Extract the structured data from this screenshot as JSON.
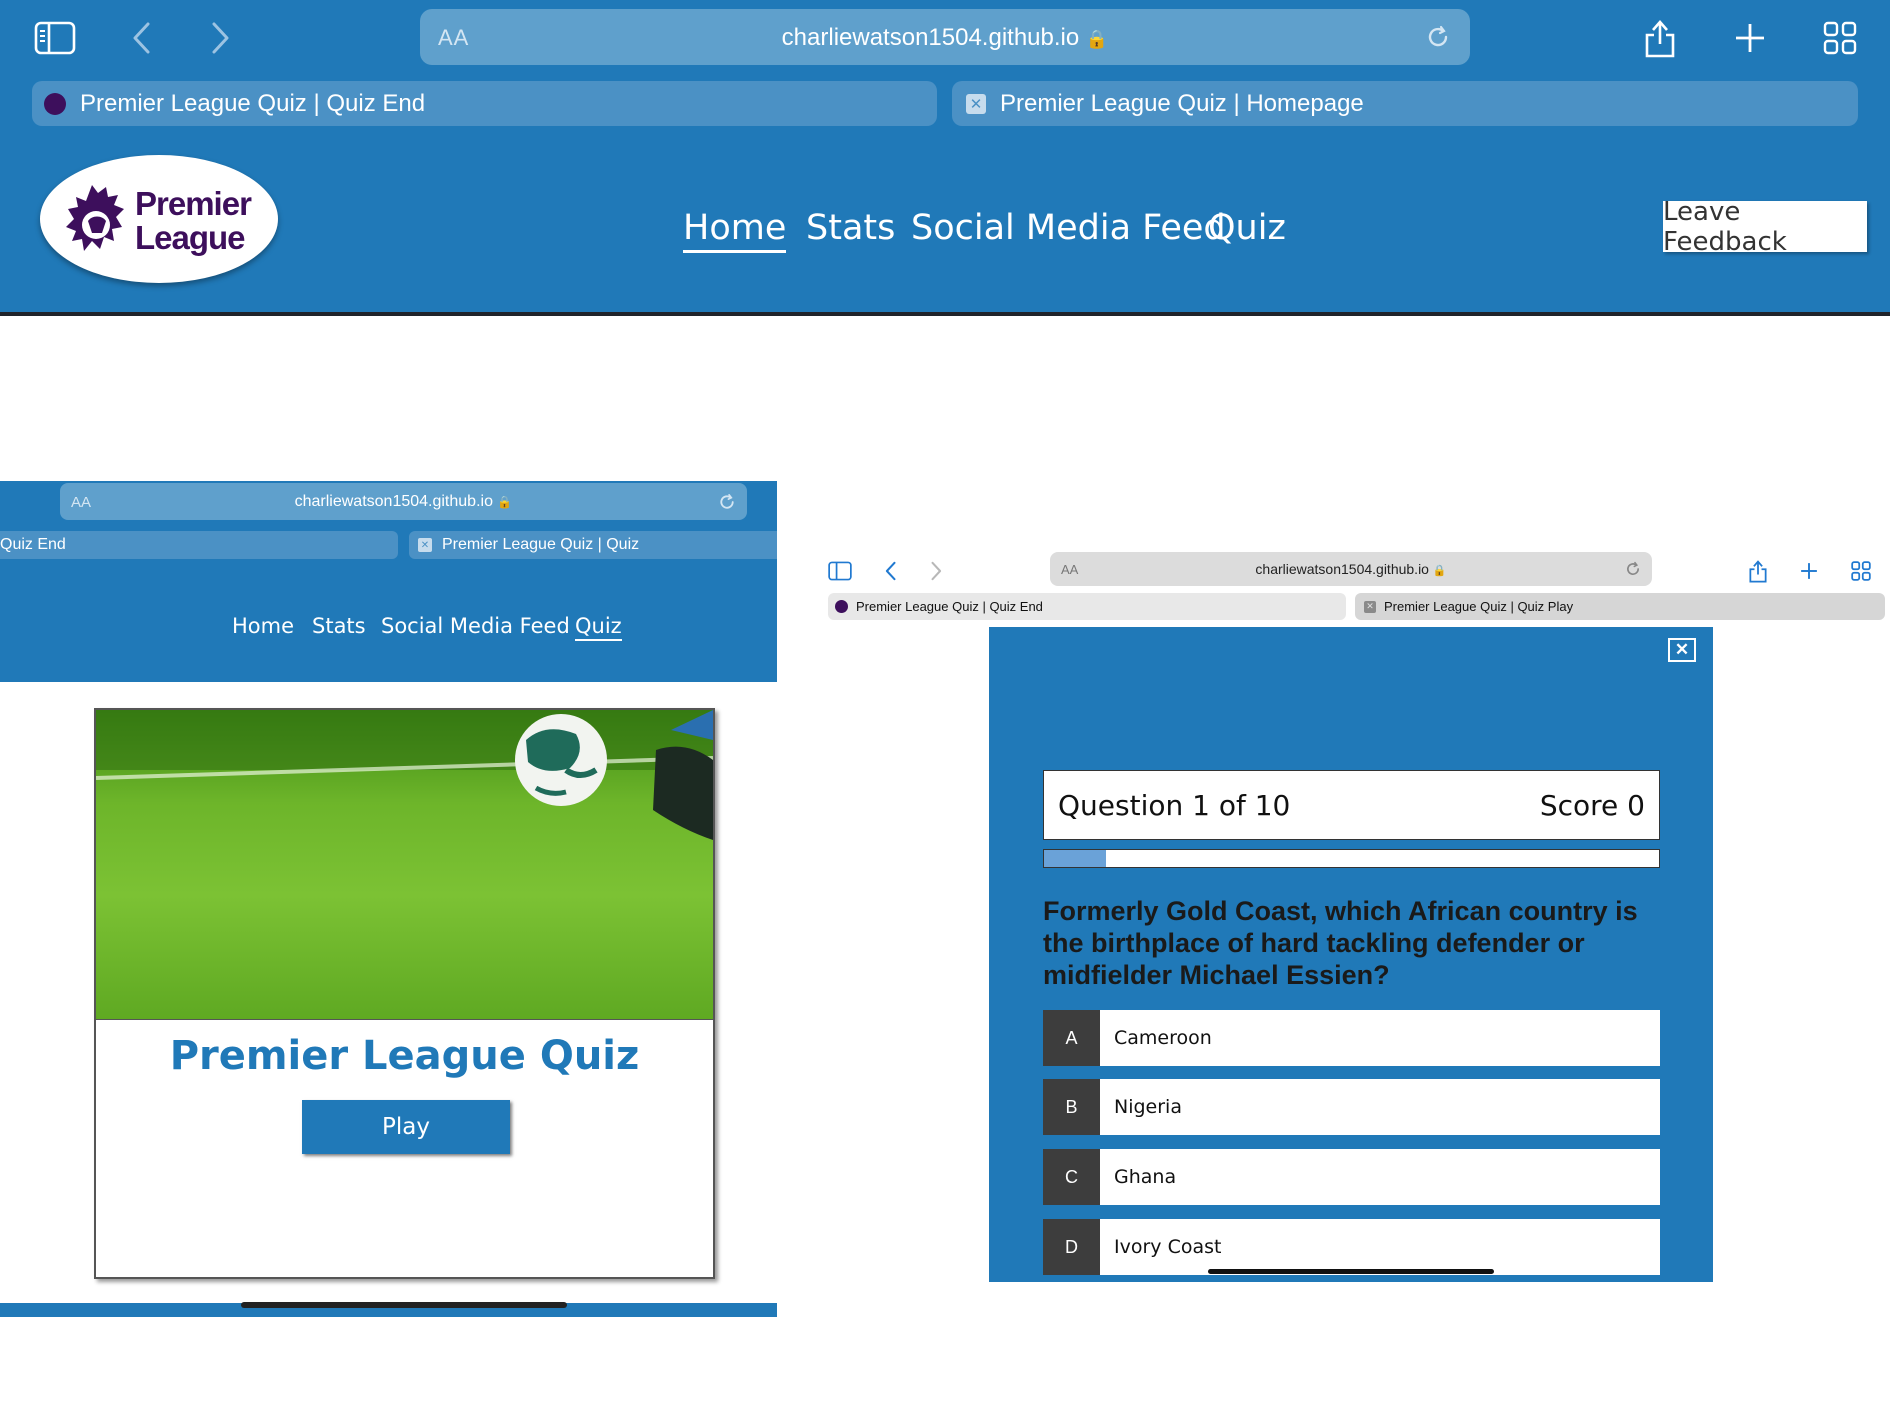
{
  "top": {
    "url_aa": "AA",
    "domain": "charliewatson1504.github.io",
    "tabs": [
      {
        "label": "Premier League Quiz | Quiz End"
      },
      {
        "label": "Premier League Quiz | Homepage"
      }
    ],
    "logo": {
      "line1": "Premier",
      "line2": "League"
    },
    "nav": [
      "Home",
      "Stats",
      "Social Media Feed",
      "Quiz"
    ],
    "active_nav": "Home",
    "feedback_label": "Leave Feedback"
  },
  "bottom_left": {
    "url_aa": "AA",
    "domain": "charliewatson1504.github.io",
    "tabs": [
      {
        "label": "Quiz End"
      },
      {
        "label": "Premier League Quiz | Quiz"
      }
    ],
    "nav": [
      "Home",
      "Stats",
      "Social Media Feed",
      "Quiz"
    ],
    "active_nav": "Quiz",
    "card_title": "Premier League Quiz",
    "play_label": "Play"
  },
  "bottom_right": {
    "url_aa": "AA",
    "domain": "charliewatson1504.github.io",
    "tabs": [
      {
        "label": "Premier League Quiz | Quiz End"
      },
      {
        "label": "Premier League Quiz | Quiz Play"
      }
    ],
    "close_label": "✕",
    "question_counter": "Question 1 of 10",
    "score": "Score 0",
    "progress_fraction": 0.1,
    "question": "Formerly Gold Coast, which African country is the birthplace of hard tackling defender or midfielder Michael Essien?",
    "answers": [
      {
        "letter": "A",
        "text": "Cameroon"
      },
      {
        "letter": "B",
        "text": "Nigeria"
      },
      {
        "letter": "C",
        "text": "Ghana"
      },
      {
        "letter": "D",
        "text": "Ivory Coast"
      }
    ]
  },
  "colors": {
    "brand_blue": "#2079b8",
    "pl_purple": "#3d0f5c",
    "answer_letter_bg": "#3d3d3d"
  }
}
